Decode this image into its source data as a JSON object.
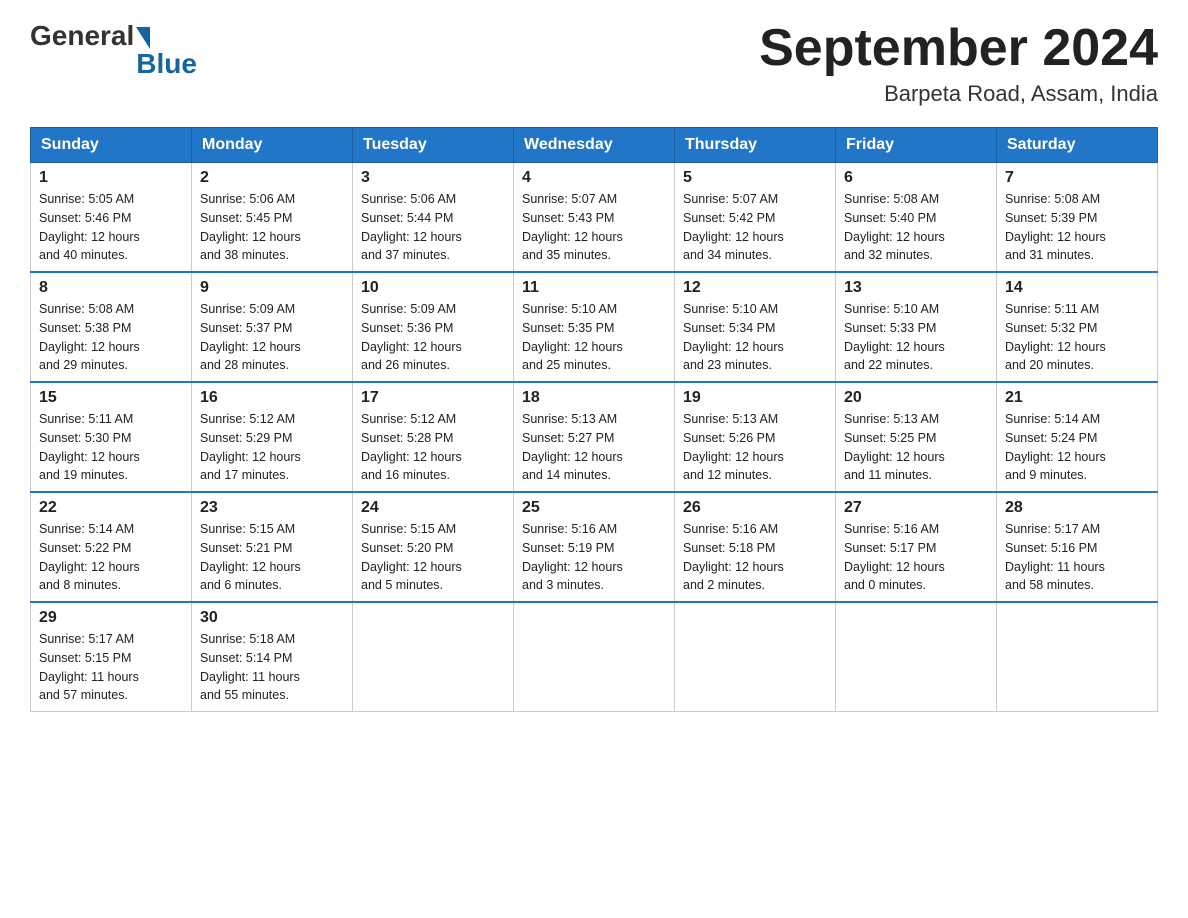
{
  "header": {
    "logo_general": "General",
    "logo_blue": "Blue",
    "month_title": "September 2024",
    "location": "Barpeta Road, Assam, India"
  },
  "days_header": [
    "Sunday",
    "Monday",
    "Tuesday",
    "Wednesday",
    "Thursday",
    "Friday",
    "Saturday"
  ],
  "weeks": [
    [
      {
        "date": "1",
        "sunrise": "5:05 AM",
        "sunset": "5:46 PM",
        "daylight": "12 hours and 40 minutes."
      },
      {
        "date": "2",
        "sunrise": "5:06 AM",
        "sunset": "5:45 PM",
        "daylight": "12 hours and 38 minutes."
      },
      {
        "date": "3",
        "sunrise": "5:06 AM",
        "sunset": "5:44 PM",
        "daylight": "12 hours and 37 minutes."
      },
      {
        "date": "4",
        "sunrise": "5:07 AM",
        "sunset": "5:43 PM",
        "daylight": "12 hours and 35 minutes."
      },
      {
        "date": "5",
        "sunrise": "5:07 AM",
        "sunset": "5:42 PM",
        "daylight": "12 hours and 34 minutes."
      },
      {
        "date": "6",
        "sunrise": "5:08 AM",
        "sunset": "5:40 PM",
        "daylight": "12 hours and 32 minutes."
      },
      {
        "date": "7",
        "sunrise": "5:08 AM",
        "sunset": "5:39 PM",
        "daylight": "12 hours and 31 minutes."
      }
    ],
    [
      {
        "date": "8",
        "sunrise": "5:08 AM",
        "sunset": "5:38 PM",
        "daylight": "12 hours and 29 minutes."
      },
      {
        "date": "9",
        "sunrise": "5:09 AM",
        "sunset": "5:37 PM",
        "daylight": "12 hours and 28 minutes."
      },
      {
        "date": "10",
        "sunrise": "5:09 AM",
        "sunset": "5:36 PM",
        "daylight": "12 hours and 26 minutes."
      },
      {
        "date": "11",
        "sunrise": "5:10 AM",
        "sunset": "5:35 PM",
        "daylight": "12 hours and 25 minutes."
      },
      {
        "date": "12",
        "sunrise": "5:10 AM",
        "sunset": "5:34 PM",
        "daylight": "12 hours and 23 minutes."
      },
      {
        "date": "13",
        "sunrise": "5:10 AM",
        "sunset": "5:33 PM",
        "daylight": "12 hours and 22 minutes."
      },
      {
        "date": "14",
        "sunrise": "5:11 AM",
        "sunset": "5:32 PM",
        "daylight": "12 hours and 20 minutes."
      }
    ],
    [
      {
        "date": "15",
        "sunrise": "5:11 AM",
        "sunset": "5:30 PM",
        "daylight": "12 hours and 19 minutes."
      },
      {
        "date": "16",
        "sunrise": "5:12 AM",
        "sunset": "5:29 PM",
        "daylight": "12 hours and 17 minutes."
      },
      {
        "date": "17",
        "sunrise": "5:12 AM",
        "sunset": "5:28 PM",
        "daylight": "12 hours and 16 minutes."
      },
      {
        "date": "18",
        "sunrise": "5:13 AM",
        "sunset": "5:27 PM",
        "daylight": "12 hours and 14 minutes."
      },
      {
        "date": "19",
        "sunrise": "5:13 AM",
        "sunset": "5:26 PM",
        "daylight": "12 hours and 12 minutes."
      },
      {
        "date": "20",
        "sunrise": "5:13 AM",
        "sunset": "5:25 PM",
        "daylight": "12 hours and 11 minutes."
      },
      {
        "date": "21",
        "sunrise": "5:14 AM",
        "sunset": "5:24 PM",
        "daylight": "12 hours and 9 minutes."
      }
    ],
    [
      {
        "date": "22",
        "sunrise": "5:14 AM",
        "sunset": "5:22 PM",
        "daylight": "12 hours and 8 minutes."
      },
      {
        "date": "23",
        "sunrise": "5:15 AM",
        "sunset": "5:21 PM",
        "daylight": "12 hours and 6 minutes."
      },
      {
        "date": "24",
        "sunrise": "5:15 AM",
        "sunset": "5:20 PM",
        "daylight": "12 hours and 5 minutes."
      },
      {
        "date": "25",
        "sunrise": "5:16 AM",
        "sunset": "5:19 PM",
        "daylight": "12 hours and 3 minutes."
      },
      {
        "date": "26",
        "sunrise": "5:16 AM",
        "sunset": "5:18 PM",
        "daylight": "12 hours and 2 minutes."
      },
      {
        "date": "27",
        "sunrise": "5:16 AM",
        "sunset": "5:17 PM",
        "daylight": "12 hours and 0 minutes."
      },
      {
        "date": "28",
        "sunrise": "5:17 AM",
        "sunset": "5:16 PM",
        "daylight": "11 hours and 58 minutes."
      }
    ],
    [
      {
        "date": "29",
        "sunrise": "5:17 AM",
        "sunset": "5:15 PM",
        "daylight": "11 hours and 57 minutes."
      },
      {
        "date": "30",
        "sunrise": "5:18 AM",
        "sunset": "5:14 PM",
        "daylight": "11 hours and 55 minutes."
      },
      null,
      null,
      null,
      null,
      null
    ]
  ],
  "labels": {
    "sunrise": "Sunrise:",
    "sunset": "Sunset:",
    "daylight": "Daylight:"
  }
}
